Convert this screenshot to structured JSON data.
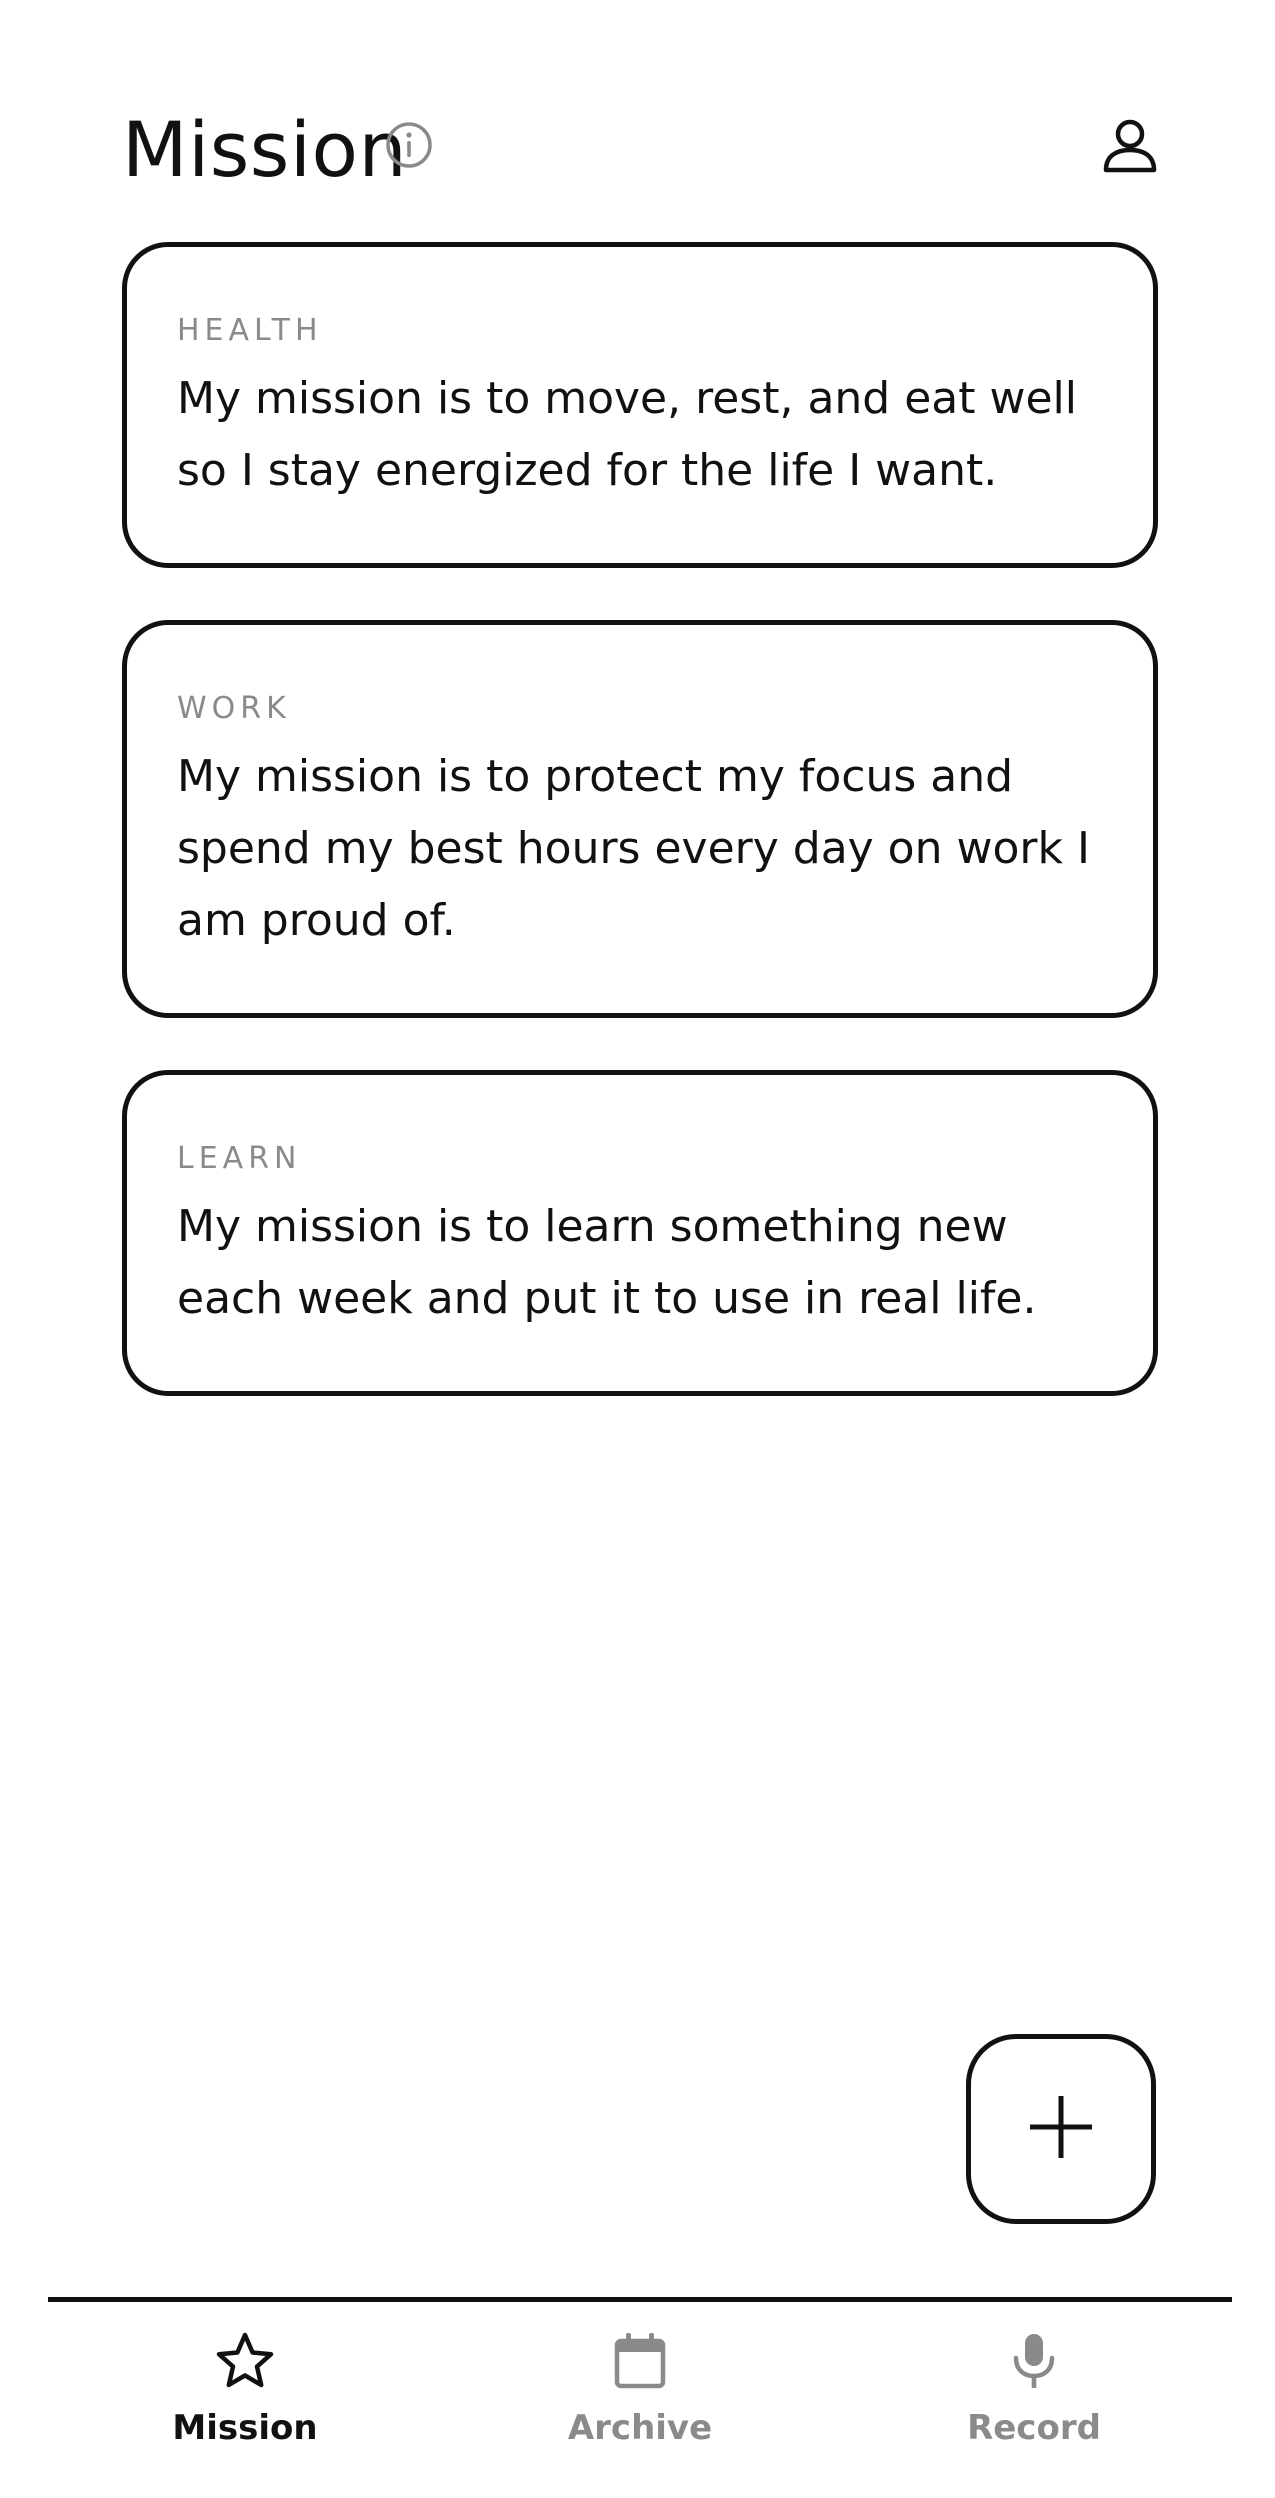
{
  "header": {
    "title": "Mission",
    "info_icon": "info-icon",
    "profile_icon": "user-icon"
  },
  "missions": [
    {
      "category": "HEALTH",
      "text": "My mission is to move, rest, and eat well so I stay energized for the life I want."
    },
    {
      "category": "WORK",
      "text": "My mission is to protect my focus and spend my best hours every day on work I am proud of."
    },
    {
      "category": "LEARN",
      "text": "My mission is to learn something new each week and put it to use in real life."
    }
  ],
  "fab": {
    "icon": "plus-icon"
  },
  "nav": {
    "items": [
      {
        "label": "Mission",
        "icon": "star-icon",
        "active": true
      },
      {
        "label": "Archive",
        "icon": "calendar-icon",
        "active": false
      },
      {
        "label": "Record",
        "icon": "microphone-icon",
        "active": false
      }
    ]
  },
  "colors": {
    "foreground": "#111111",
    "muted": "#8a8a8a",
    "background": "#ffffff"
  }
}
